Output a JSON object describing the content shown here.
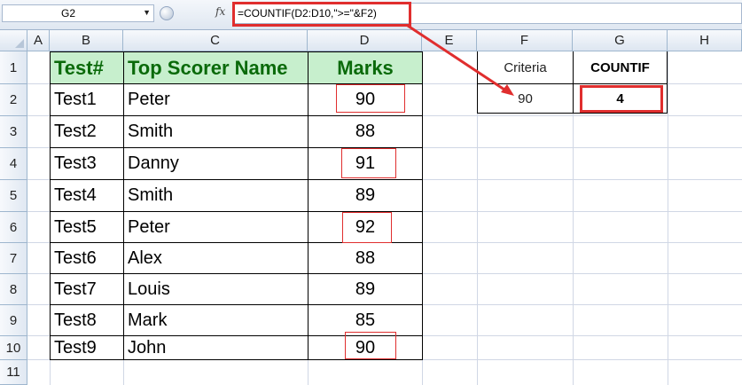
{
  "formula_bar": {
    "name_box": "G2",
    "fx_label": "fx",
    "formula": "=COUNTIF(D2:D10,\">=\"&F2)"
  },
  "columns": [
    "A",
    "B",
    "C",
    "D",
    "E",
    "F",
    "G",
    "H"
  ],
  "rows": [
    "1",
    "2",
    "3",
    "4",
    "5",
    "6",
    "7",
    "8",
    "9",
    "10",
    "11"
  ],
  "table": {
    "headers": [
      "Test#",
      "Top Scorer Name",
      "Marks"
    ],
    "rows": [
      [
        "Test1",
        "Peter",
        "90"
      ],
      [
        "Test2",
        "Smith",
        "88"
      ],
      [
        "Test3",
        "Danny",
        "91"
      ],
      [
        "Test4",
        "Smith",
        "89"
      ],
      [
        "Test5",
        "Peter",
        "92"
      ],
      [
        "Test6",
        "Alex",
        "88"
      ],
      [
        "Test7",
        "Louis",
        "89"
      ],
      [
        "Test8",
        "Mark",
        "85"
      ],
      [
        "Test9",
        "John",
        "90"
      ]
    ]
  },
  "side": {
    "criteria_label": "Criteria",
    "countif_label": "COUNTIF",
    "criteria_value": "90",
    "countif_value": "4"
  },
  "colors": {
    "header_fill": "#c7efcd",
    "header_text": "#0a6a0a",
    "highlight": "#e02e2e"
  }
}
